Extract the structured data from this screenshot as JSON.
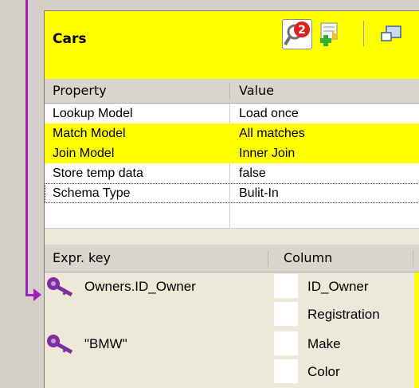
{
  "table": {
    "title": "Cars",
    "toolbar": [
      {
        "icon": "search-problems-icon",
        "badge": "2"
      },
      {
        "icon": "add-row-icon"
      },
      {
        "icon": "window-icon"
      }
    ]
  },
  "properties": {
    "headers": {
      "property": "Property",
      "value": "Value"
    },
    "rows": [
      {
        "property": "Lookup Model",
        "value": "Load once"
      },
      {
        "property": "Match Model",
        "value": "All matches"
      },
      {
        "property": "Join Model",
        "value": "Inner Join"
      },
      {
        "property": "Store temp data",
        "value": "false"
      },
      {
        "property": "Schema Type",
        "value": "Bulit-In"
      }
    ]
  },
  "expressions": {
    "headers": {
      "expr_key": "Expr. key",
      "column": "Column"
    },
    "rows": [
      {
        "expr": "Owners.ID_Owner",
        "column": "ID_Owner"
      },
      {
        "expr": "",
        "column": "Registration"
      },
      {
        "expr": "\"BMW\"",
        "column": "Make"
      },
      {
        "expr": "",
        "column": "Color"
      }
    ]
  },
  "colors": {
    "highlight": "#ffff00",
    "link": "#a020c0",
    "key": "#7b2fa0"
  }
}
